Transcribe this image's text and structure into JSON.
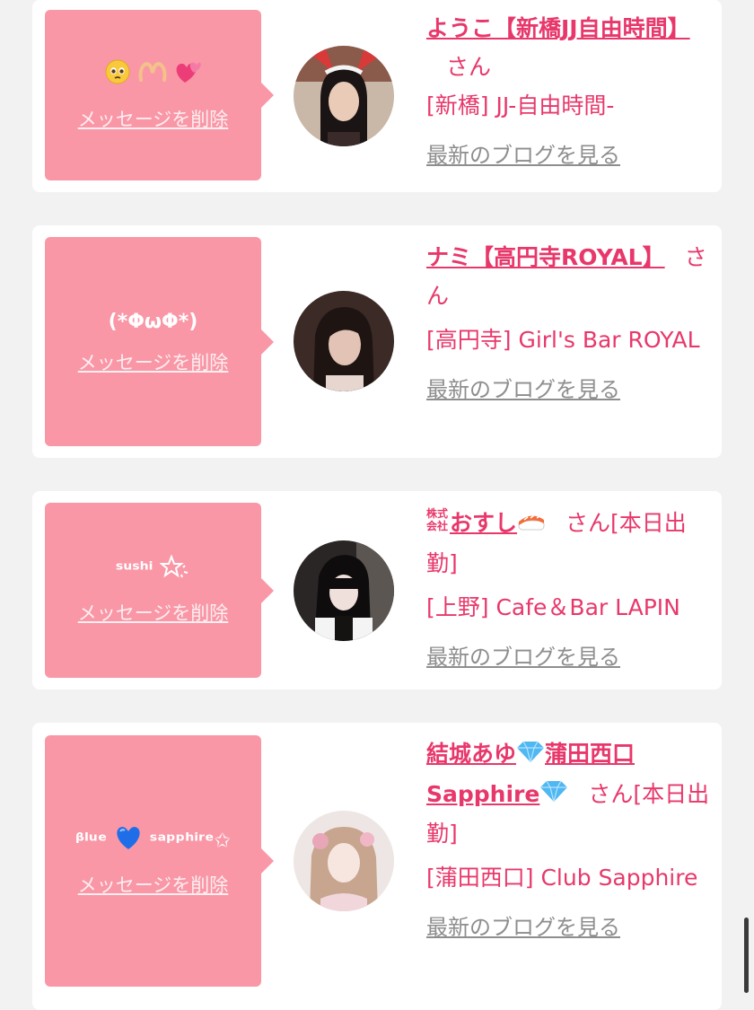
{
  "messages": [
    {
      "message": "",
      "message_icons": [
        "pleading-face-icon",
        "heart-hands-icon",
        "two-hearts-icon"
      ],
      "delete_label": "メッセージを削除",
      "name": "ようこ【新橋JJ自由時間】",
      "honorific": "さん",
      "shop": "[新橋] JJ-自由時間-",
      "blog_link": "最新のブログを見る"
    },
    {
      "message": "(*ΦωΦ*)",
      "delete_label": "メッセージを削除",
      "name": "ナミ【高円寺ROYAL】",
      "honorific": "さん",
      "shop": "[高円寺] Girl's Bar ROYAL",
      "blog_link": "最新のブログを見る"
    },
    {
      "message": "ˢᵘˢʰⁱ",
      "message_icons": [
        "sparkle-star-icon"
      ],
      "delete_label": "メッセージを削除",
      "name": "おすし",
      "name_prefix_icon": "kabushiki-gaisha-icon",
      "name_suffix_icon": "sushi-icon",
      "honorific": "さん[本日出勤]",
      "shop": "[上野] Cafe＆Bar LAPIN",
      "blog_link": "最新のブログを見る"
    },
    {
      "message": "ᵝˡᵘᵉ",
      "message_end": "ˢᵃᵖᵖʰⁱʳᵉ✩",
      "message_icons": [
        "blue-heart-icon"
      ],
      "delete_label": "メッセージを削除",
      "name": "結城あゆ",
      "name_mid": "蒲田西口Sapphire",
      "name_icons": [
        "gem-icon",
        "gem-icon"
      ],
      "honorific": "さん[本日出勤]",
      "shop": "[蒲田西口] Club Sapphire",
      "blog_link": "最新のブログを見る"
    }
  ],
  "colors": {
    "accent": "#e8386b",
    "bubble": "#f997a6",
    "background": "#f2f2f2",
    "link_gray": "#8e8e8e"
  }
}
